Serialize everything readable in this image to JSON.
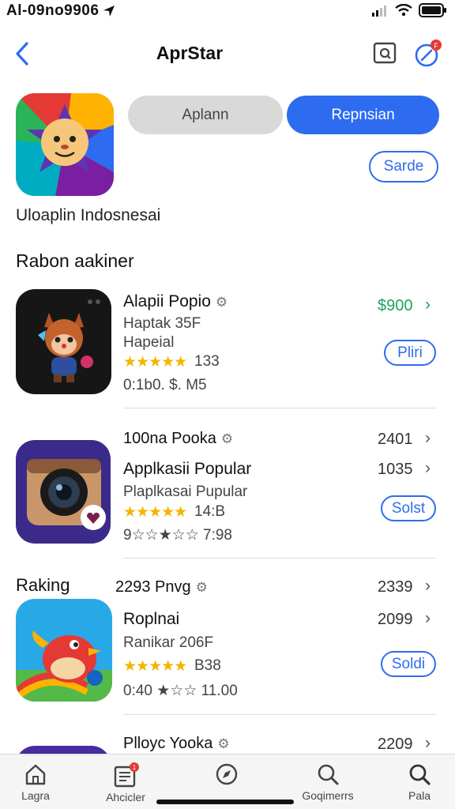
{
  "status_bar": {
    "time": "Al-09no9906"
  },
  "nav": {
    "title": "AprStar",
    "badge": "F"
  },
  "segments": {
    "left": "Aplann",
    "right": "Repnsian"
  },
  "search_chip": "Sarde",
  "region_label": "Uloaplin Indosnesai",
  "section_title": "Rabon aakiner",
  "ranking_label": "Raking",
  "apps": [
    {
      "title": "Alapii Popio",
      "sub1": "Haptak 35F",
      "sub2": "Hapeial",
      "rating_count": "133",
      "meta": "0:1b0. $. M5",
      "right_value": "$900",
      "button": "Pliri"
    },
    {
      "header": "100na Pooka",
      "header_value": "2401",
      "title": "Applkasii Popular",
      "title_value": "1035",
      "sub1": "Plaplkasai Pupular",
      "rating_count": "14:B",
      "meta": "9☆☆★☆☆  7:98",
      "button": "Solst"
    },
    {
      "header": "2293 Pnvg",
      "header_value": "2339",
      "title": "Roplnai",
      "title_value": "2099",
      "sub1": "Ranikar 206F",
      "rating_count": "B38",
      "meta": "0:40 ★☆☆ 11.00",
      "button": "Soldi"
    },
    {
      "header": "Plloyc Yooka",
      "header_value": "2209"
    }
  ],
  "stars": "★★★★★",
  "chevron": "›",
  "tabs": [
    {
      "label": "Lagra",
      "icon": "home-icon"
    },
    {
      "label": "Ahcicler",
      "icon": "news-icon",
      "badge": "1"
    },
    {
      "label": "",
      "icon": "compass-icon"
    },
    {
      "label": "Goqimerrs",
      "icon": "search-icon"
    },
    {
      "label": "Pala",
      "icon": "search-icon"
    }
  ],
  "colors": {
    "accent": "#2d6cf0",
    "price_green": "#1aa35a",
    "star": "#f5b400",
    "badge_red": "#e53935"
  }
}
